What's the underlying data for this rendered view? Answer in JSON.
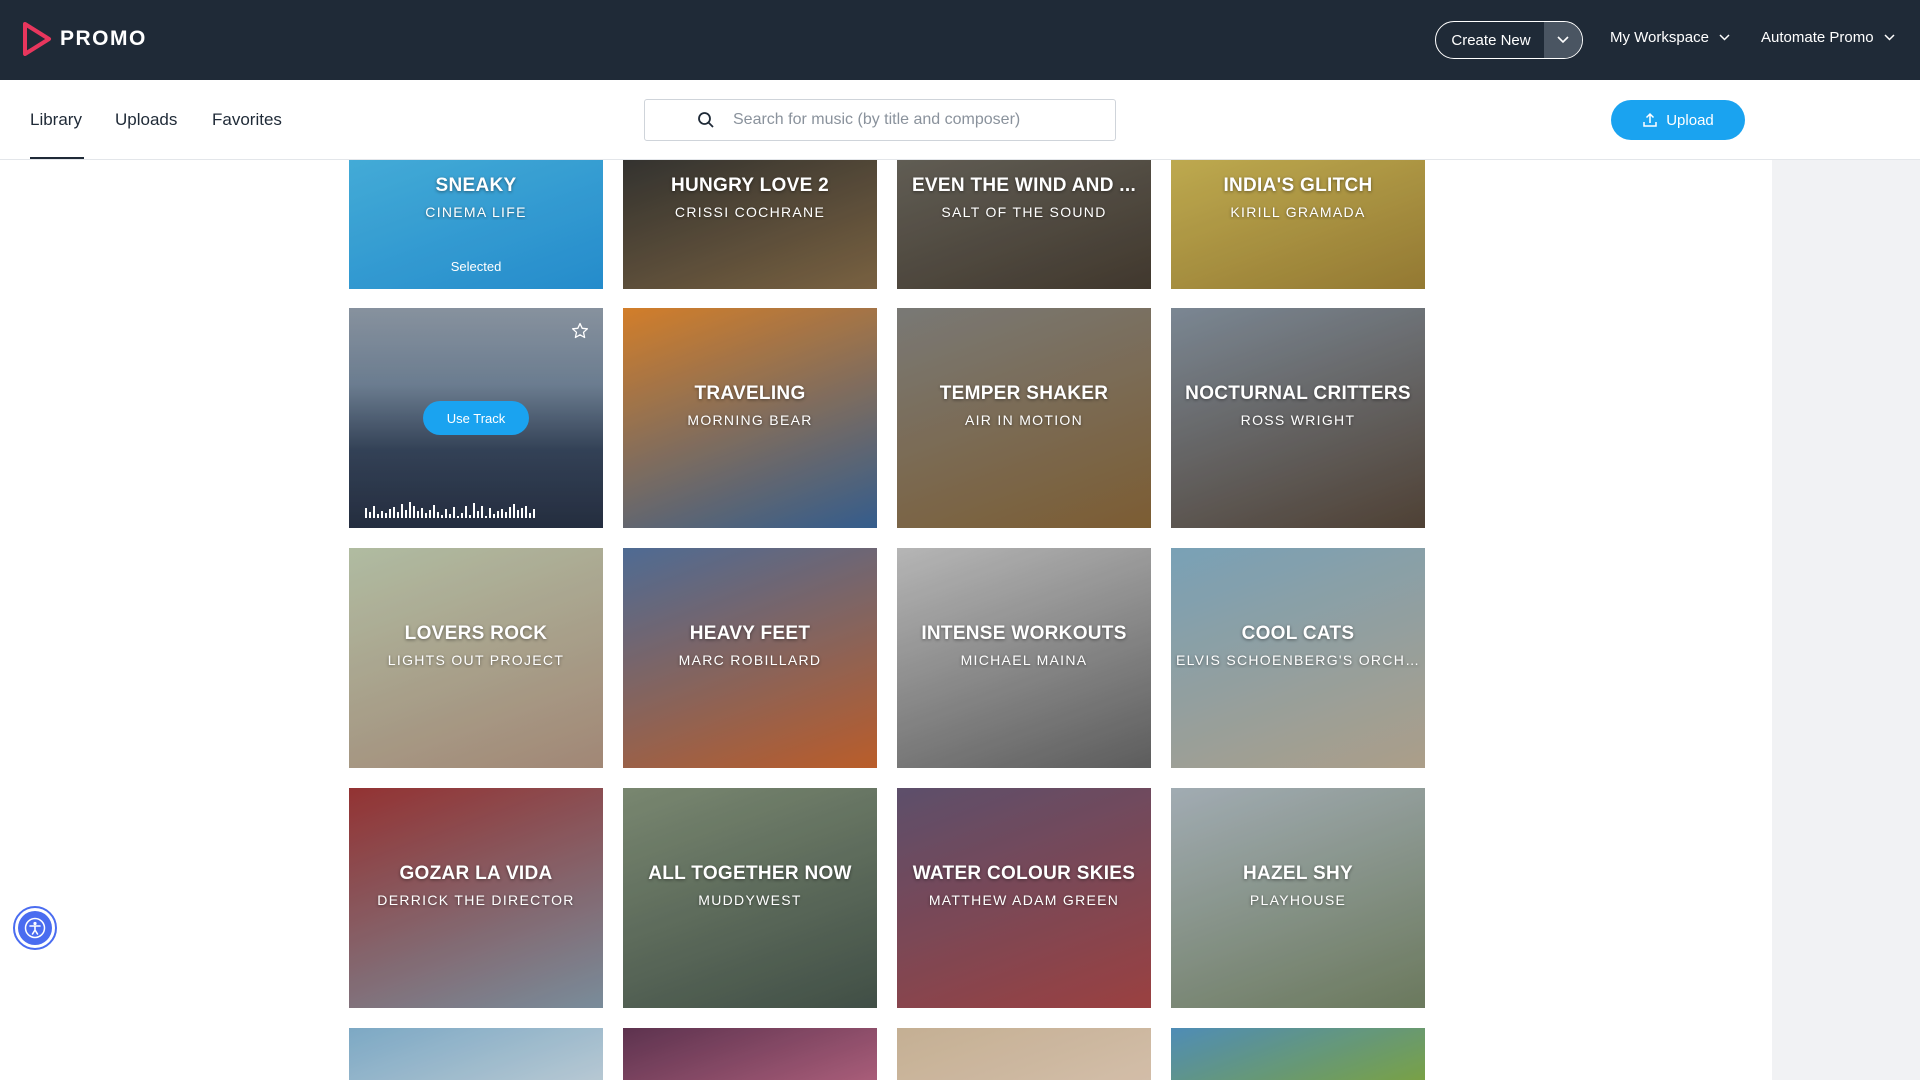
{
  "brand": {
    "name": "PROMO",
    "accent": "#1aa3f0",
    "logo_color": "#e8365d"
  },
  "topnav": {
    "create_new": "Create New",
    "my_workspace": "My Workspace",
    "automate_promo": "Automate Promo"
  },
  "tabs": [
    {
      "label": "Library",
      "active": true
    },
    {
      "label": "Uploads",
      "active": false
    },
    {
      "label": "Favorites",
      "active": false
    }
  ],
  "search": {
    "placeholder": "Search for music (by title and composer)",
    "value": ""
  },
  "upload_button": "Upload",
  "selected_label": "Selected",
  "use_track_label": "Use Track",
  "tracks": [
    {
      "title": "SNEAKY",
      "artist": "CINEMA LIFE",
      "state": "selected",
      "colors": [
        "#4dc3f5",
        "#2a9fe8"
      ]
    },
    {
      "title": "HUNGRY LOVE 2",
      "artist": "CRISSI COCHRANE",
      "state": "",
      "colors": [
        "#3b3a36",
        "#8a6f4a"
      ]
    },
    {
      "title": "EVEN THE WIND AND ...",
      "artist": "SALT OF THE SOUND",
      "state": "",
      "colors": [
        "#6e6a60",
        "#4a4034"
      ]
    },
    {
      "title": "INDIA'S GLITCH",
      "artist": "KIRILL GRAMADA",
      "state": "",
      "colors": [
        "#d8c15a",
        "#a88a3a"
      ]
    },
    {
      "title": "",
      "artist": "",
      "state": "hover",
      "colors": [
        "#9fa8b4",
        "#3e4a5c"
      ]
    },
    {
      "title": "TRAVELING",
      "artist": "MORNING BEAR",
      "state": "",
      "colors": [
        "#f09030",
        "#3c6aa0"
      ]
    },
    {
      "title": "TEMPER SHAKER",
      "artist": "AIR IN MOTION",
      "state": "",
      "colors": [
        "#8a8a86",
        "#8e6a3a"
      ]
    },
    {
      "title": "NOCTURNAL CRITTERS",
      "artist": "ROSS WRIGHT",
      "state": "",
      "colors": [
        "#8c9aa8",
        "#5a4a3c"
      ]
    },
    {
      "title": "LOVERS ROCK",
      "artist": "LIGHTS OUT PROJECT",
      "state": "",
      "colors": [
        "#c9d6b8",
        "#b89a86"
      ]
    },
    {
      "title": "HEAVY FEET",
      "artist": "MARC ROBILLARD",
      "state": "",
      "colors": [
        "#5a7aa8",
        "#d46a30"
      ]
    },
    {
      "title": "INTENSE WORKOUTS",
      "artist": "MICHAEL MAINA",
      "state": "",
      "colors": [
        "#cfcfcf",
        "#6a6a6a"
      ]
    },
    {
      "title": "COOL CATS",
      "artist": "ELVIS SCHOENBERG'S ORCHE...",
      "state": "",
      "colors": [
        "#8ab8d0",
        "#c4b49c"
      ]
    },
    {
      "title": "GOZAR LA VIDA",
      "artist": "DERRICK THE DIRECTOR",
      "state": "",
      "colors": [
        "#a83a3a",
        "#8aa0b0"
      ]
    },
    {
      "title": "ALL TOGETHER NOW",
      "artist": "MUDDYWEST",
      "state": "",
      "colors": [
        "#8a9a80",
        "#4a5a50"
      ]
    },
    {
      "title": "WATER COLOUR SKIES",
      "artist": "MATTHEW ADAM GREEN",
      "state": "",
      "colors": [
        "#6a5a7a",
        "#b04a4a"
      ]
    },
    {
      "title": "HAZEL SHY",
      "artist": "PLAYHOUSE",
      "state": "",
      "colors": [
        "#b8c4cc",
        "#7a8a6a"
      ]
    },
    {
      "title": "",
      "artist": "",
      "state": "",
      "colors": [
        "#8ec0e0",
        "#d0e4f0"
      ]
    },
    {
      "title": "",
      "artist": "",
      "state": "",
      "colors": [
        "#6a3a5a",
        "#c06a8a"
      ]
    },
    {
      "title": "",
      "artist": "",
      "state": "",
      "colors": [
        "#e0c8a8",
        "#f0d8c0"
      ]
    },
    {
      "title": "",
      "artist": "",
      "state": "",
      "colors": [
        "#5aa0d0",
        "#8ab850"
      ]
    }
  ]
}
